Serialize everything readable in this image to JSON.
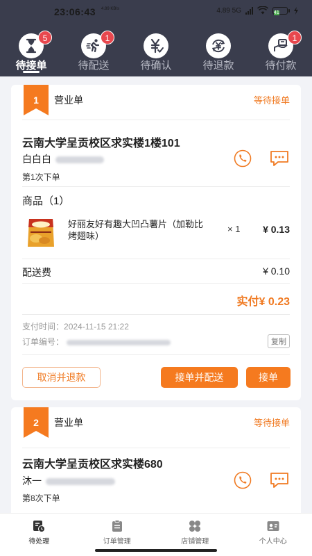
{
  "status_bar": {
    "time": "23:06:43",
    "speed_small": "4.89 KB/s",
    "net": "4.89 5G",
    "battery_level": "41"
  },
  "tabs": [
    {
      "label": "待接单",
      "badge": "5",
      "icon": "hourglass-icon",
      "active": true
    },
    {
      "label": "待配送",
      "badge": "1",
      "icon": "runner-icon",
      "active": false
    },
    {
      "label": "待确认",
      "badge": "",
      "icon": "yuan-check-icon",
      "active": false
    },
    {
      "label": "待退款",
      "badge": "",
      "icon": "yuan-refund-icon",
      "active": false
    },
    {
      "label": "待付款",
      "badge": "1",
      "icon": "payment-hand-icon",
      "active": false
    }
  ],
  "orders": [
    {
      "index": "1",
      "type": "营业单",
      "status": "等待接单",
      "address": "云南大学呈贡校区求实楼1楼101",
      "customer": "白白白",
      "order_count": "第1次下单",
      "goods_title": "商品（1）",
      "goods": [
        {
          "name": "好丽友好有趣大凹凸薯片（加勒比烤翅味）",
          "qty": "× 1",
          "price": "¥ 0.13"
        }
      ],
      "fee_label": "配送费",
      "fee_value": "¥ 0.10",
      "paid": "实付¥ 0.23",
      "pay_time_label": "支付时间：",
      "pay_time": "2024-11-15 21:22",
      "order_no_label": "订单编号：",
      "copy_label": "复制",
      "buttons": {
        "cancel": "取消并退款",
        "accept_deliver": "接单并配送",
        "accept": "接单"
      }
    },
    {
      "index": "2",
      "type": "营业单",
      "status": "等待接单",
      "address": "云南大学呈贡校区求实楼680",
      "customer": "沐一",
      "order_count": "第8次下单"
    }
  ],
  "bottom_nav": [
    {
      "label": "待处理",
      "icon": "pending-icon",
      "active": true
    },
    {
      "label": "订单管理",
      "icon": "order-icon",
      "active": false
    },
    {
      "label": "店铺管理",
      "icon": "store-icon",
      "active": false
    },
    {
      "label": "个人中心",
      "icon": "profile-icon",
      "active": false
    }
  ],
  "colors": {
    "header": "#3a3d4d",
    "accent": "#f57a1f",
    "badge": "#e8474e"
  }
}
